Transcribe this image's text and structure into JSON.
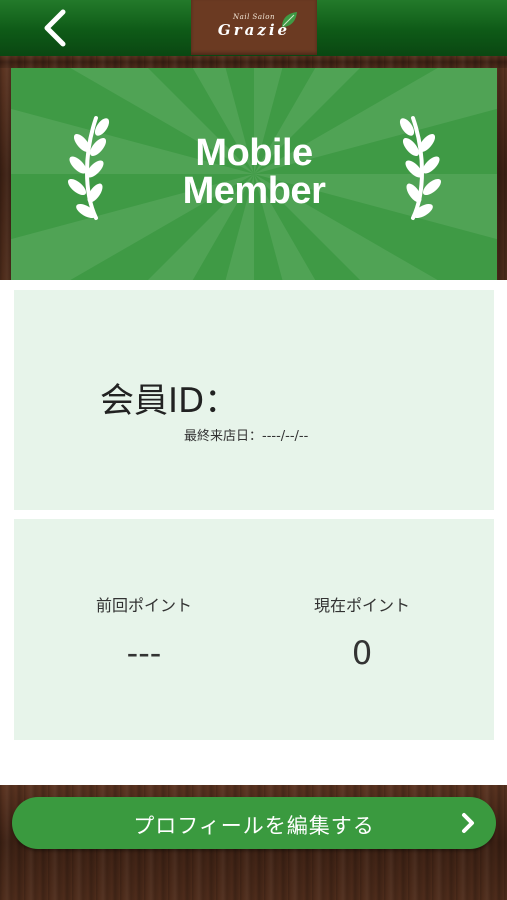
{
  "header": {
    "back_icon": "chevron-left-icon",
    "logo_small": "Nail Salon",
    "logo_main": "Grazie"
  },
  "hero": {
    "title_line1": "Mobile",
    "title_line2": "Member",
    "decoration_icon": "laurel-branch-icon"
  },
  "member": {
    "id_label": "会員ID：",
    "id_value": "",
    "last_visit_label": "最終来店日：",
    "last_visit_value": "----/--/--"
  },
  "points": {
    "previous_label": "前回ポイント",
    "previous_value": "---",
    "current_label": "現在ポイント",
    "current_value": "0"
  },
  "profile_button": {
    "label": "プロフィールを編集する",
    "icon": "chevron-right-icon"
  },
  "colors": {
    "header_green": "#0e5a17",
    "hero_green": "#3f9a45",
    "card_bg": "#e7f4ea",
    "button_green": "#3a9a3f",
    "logo_brown": "#6b3a22"
  }
}
